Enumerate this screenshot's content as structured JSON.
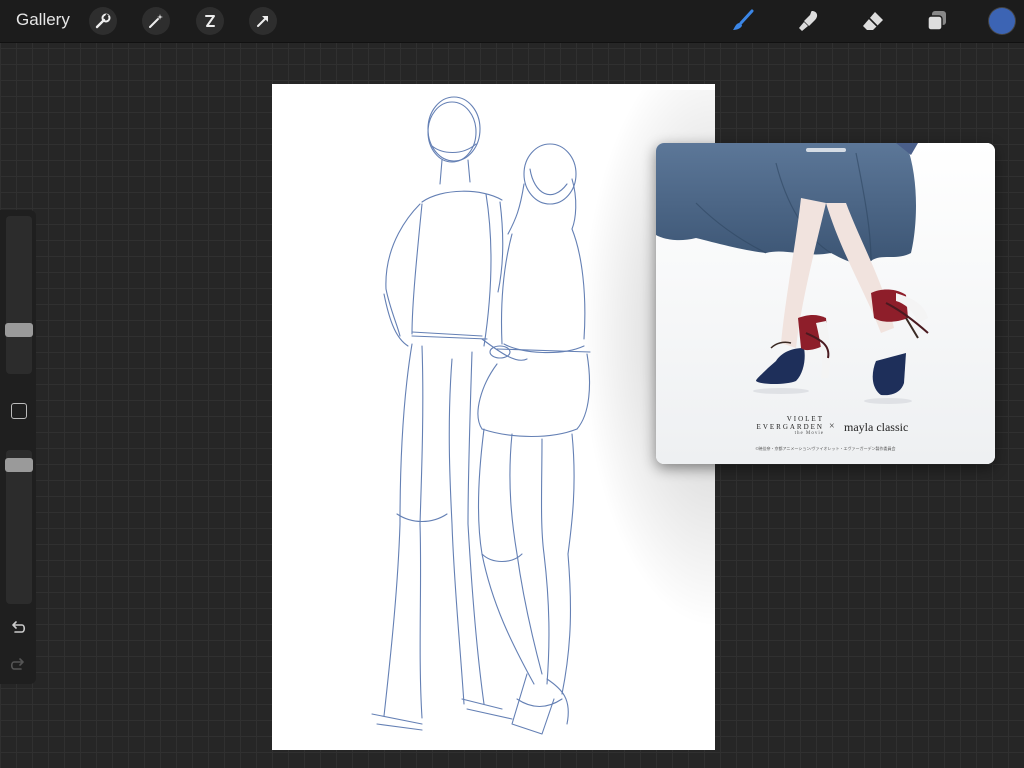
{
  "header": {
    "gallery_label": "Gallery",
    "left_tools": [
      "wrench-icon",
      "magic-wand-icon",
      "selection-icon",
      "transform-arrow-icon"
    ],
    "right_tools": [
      "brush-icon",
      "smudge-icon",
      "eraser-icon",
      "layers-icon"
    ],
    "active_tool": "brush-icon",
    "accent_color": "#3b86e6",
    "current_color": "#3c64b4"
  },
  "sidebar": {
    "brush_size_level": 0.73,
    "opacity_level": 0.93,
    "buttons": [
      "modify-button",
      "undo-icon",
      "redo-icon"
    ]
  },
  "canvas": {
    "background": "#ffffff",
    "sketch_color": "#4a6aa8"
  },
  "reference": {
    "brand_primary": "VIOLET EVERGARDEN",
    "brand_primary_line1": "VIOLET",
    "brand_primary_line2": "EVERGARDEN",
    "brand_sub": "the Movie",
    "separator": "×",
    "brand_secondary": "mayla classic",
    "copyright": "©暁佳奈・京都アニメーション/ヴァイオレット・エヴァーガーデン製作委員会"
  }
}
